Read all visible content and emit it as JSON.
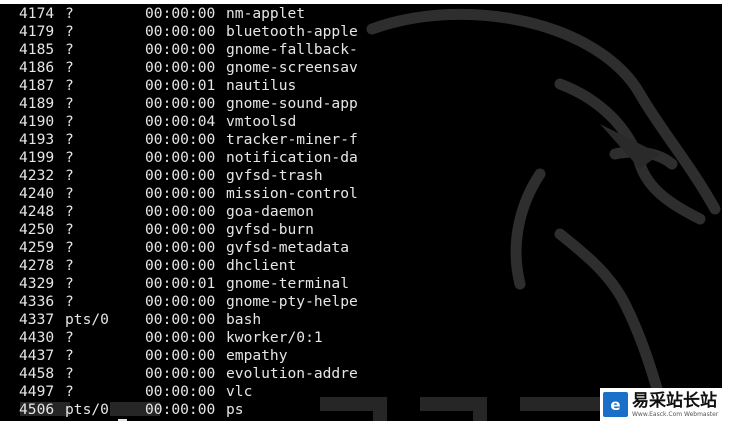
{
  "terminal": {
    "colors": {
      "background": "#000000",
      "text": "#e6e6e6"
    },
    "rows": [
      {
        "pid": "4174",
        "tty": "?",
        "time": "00:00:00",
        "cmd": "nm-applet"
      },
      {
        "pid": "4179",
        "tty": "?",
        "time": "00:00:00",
        "cmd": "bluetooth-apple"
      },
      {
        "pid": "4185",
        "tty": "?",
        "time": "00:00:00",
        "cmd": "gnome-fallback-"
      },
      {
        "pid": "4186",
        "tty": "?",
        "time": "00:00:00",
        "cmd": "gnome-screensav"
      },
      {
        "pid": "4187",
        "tty": "?",
        "time": "00:00:01",
        "cmd": "nautilus"
      },
      {
        "pid": "4189",
        "tty": "?",
        "time": "00:00:00",
        "cmd": "gnome-sound-app"
      },
      {
        "pid": "4190",
        "tty": "?",
        "time": "00:00:04",
        "cmd": "vmtoolsd"
      },
      {
        "pid": "4193",
        "tty": "?",
        "time": "00:00:00",
        "cmd": "tracker-miner-f"
      },
      {
        "pid": "4199",
        "tty": "?",
        "time": "00:00:00",
        "cmd": "notification-da"
      },
      {
        "pid": "4232",
        "tty": "?",
        "time": "00:00:00",
        "cmd": "gvfsd-trash"
      },
      {
        "pid": "4240",
        "tty": "?",
        "time": "00:00:00",
        "cmd": "mission-control"
      },
      {
        "pid": "4248",
        "tty": "?",
        "time": "00:00:00",
        "cmd": "goa-daemon"
      },
      {
        "pid": "4250",
        "tty": "?",
        "time": "00:00:00",
        "cmd": "gvfsd-burn"
      },
      {
        "pid": "4259",
        "tty": "?",
        "time": "00:00:00",
        "cmd": "gvfsd-metadata"
      },
      {
        "pid": "4278",
        "tty": "?",
        "time": "00:00:00",
        "cmd": "dhclient"
      },
      {
        "pid": "4329",
        "tty": "?",
        "time": "00:00:01",
        "cmd": "gnome-terminal"
      },
      {
        "pid": "4336",
        "tty": "?",
        "time": "00:00:00",
        "cmd": "gnome-pty-helpe"
      },
      {
        "pid": "4337",
        "tty": "pts/0",
        "time": "00:00:00",
        "cmd": "bash"
      },
      {
        "pid": "4430",
        "tty": "?",
        "time": "00:00:00",
        "cmd": "kworker/0:1"
      },
      {
        "pid": "4437",
        "tty": "?",
        "time": "00:00:00",
        "cmd": "empathy"
      },
      {
        "pid": "4458",
        "tty": "?",
        "time": "00:00:00",
        "cmd": "evolution-addre"
      },
      {
        "pid": "4497",
        "tty": "?",
        "time": "00:00:00",
        "cmd": "vlc"
      },
      {
        "pid": "4506",
        "tty": "pts/0",
        "time": "00:00:00",
        "cmd": "ps"
      }
    ]
  },
  "wallpaper": {
    "icon": "kali-dragon-logo",
    "color": "#3a3a3a"
  },
  "watermark": {
    "icon": "yiicai-logo-icon",
    "title": "易采站长站",
    "subtitle": "Www.Easck.Com Webmaster",
    "color": "#1a6fc8"
  }
}
